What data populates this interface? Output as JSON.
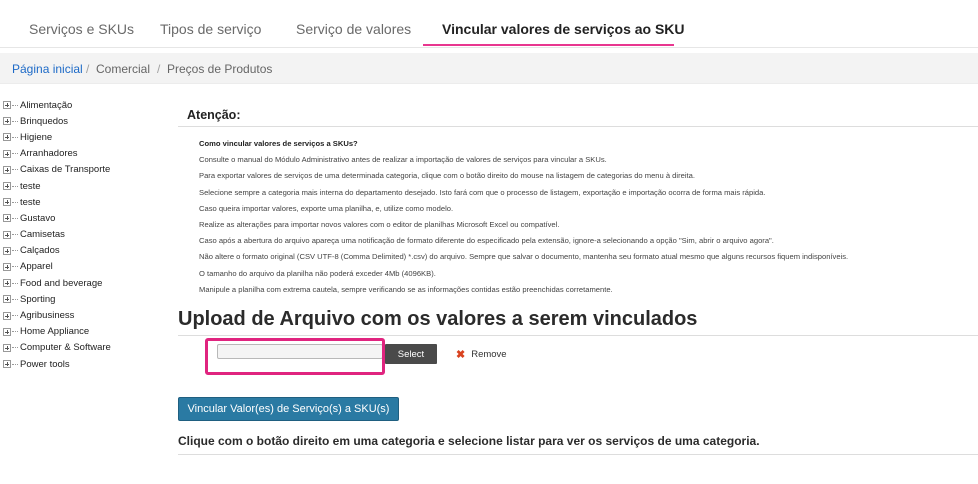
{
  "tabs": [
    {
      "label": "Serviços e SKUs",
      "active": false
    },
    {
      "label": "Tipos de serviço",
      "active": false
    },
    {
      "label": "Serviço de valores",
      "active": false
    },
    {
      "label": "Vincular valores de serviços ao SKU",
      "active": true
    }
  ],
  "accent_color": "#e8368f",
  "breadcrumb": {
    "home": "Página inicial",
    "separator": "/",
    "items": [
      "Comercial",
      "Preços de Produtos"
    ]
  },
  "tree": [
    "Alimentação",
    "Brinquedos",
    "Higiene",
    "Arranhadores",
    "Caixas de Transporte",
    "teste",
    "teste",
    "Gustavo",
    "Camisetas",
    "Calçados",
    "Apparel",
    "Food and beverage",
    "Sporting",
    "Agribusiness",
    "Home Appliance",
    "Computer & Software",
    "Power tools"
  ],
  "attention": {
    "title": "Atenção:",
    "question": "Como vincular valores de serviços a SKUs?",
    "notes": [
      "Consulte o manual do Módulo Administrativo antes de realizar a importação de valores de serviços para vincular a SKUs.",
      "Para exportar valores de serviços de uma determinada categoria, clique com o botão direito do mouse na listagem de categorias do menu à direita.",
      "Selecione sempre a categoria mais interna do departamento desejado. Isto fará com que o processo de listagem, exportação e importação ocorra de forma mais rápida.",
      "Caso queira importar valores, exporte uma planilha, e, utilize como modelo.",
      "Realize as alterações para importar novos valores com o editor de planilhas Microsoft Excel ou compatível.",
      "Caso após a abertura do arquivo apareça uma notificação de formato diferente do especificado pela extensão, ignore-a selecionando a opção \"Sim, abrir o arquivo agora\".",
      "Não altere o formato original (CSV UTF-8 (Comma Delimited) *.csv) do arquivo. Sempre que salvar o documento, mantenha seu formato atual mesmo que alguns recursos fiquem indisponíveis.",
      "O tamanho do arquivo da planilha não poderá exceder 4Mb (4096KB).",
      "Manipule a planilha com extrema cautela, sempre verificando se as informações contidas estão preenchidas corretamente."
    ]
  },
  "upload": {
    "title": "Upload de Arquivo com os valores a serem vinculados",
    "file_value": "",
    "select_label": "Select",
    "remove_label": "Remove",
    "remove_icon": "close-icon",
    "highlight_color": "#e0247f"
  },
  "submit_label": "Vincular Valor(es) de Serviço(s) a SKU(s)",
  "hint": "Clique com o botão direito em uma categoria e selecione listar para ver os serviços de uma categoria."
}
